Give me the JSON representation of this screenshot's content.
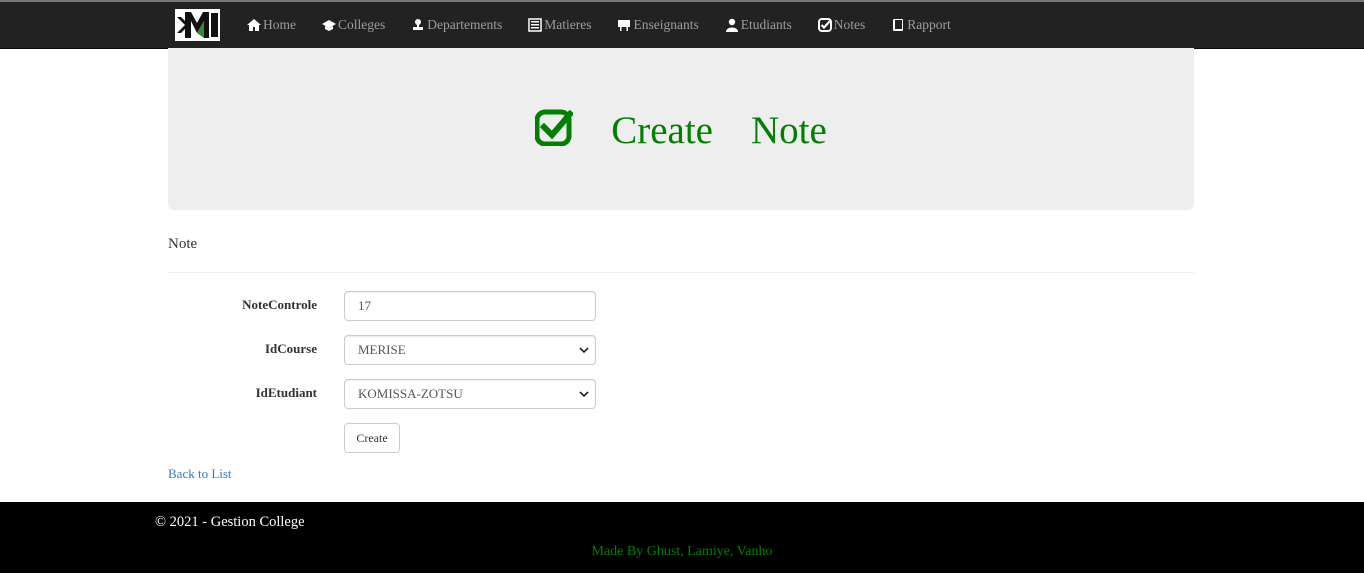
{
  "nav": {
    "items": [
      {
        "label": "Home",
        "icon": "home-icon"
      },
      {
        "label": "Colleges",
        "icon": "graduation-cap-icon"
      },
      {
        "label": "Departements",
        "icon": "stamp-icon"
      },
      {
        "label": "Matieres",
        "icon": "list-icon"
      },
      {
        "label": "Enseignants",
        "icon": "blackboard-icon"
      },
      {
        "label": "Etudiants",
        "icon": "user-icon"
      },
      {
        "label": "Notes",
        "icon": "checkbox-icon"
      },
      {
        "label": "Rapport",
        "icon": "book-icon"
      }
    ]
  },
  "header": {
    "word1": "Create",
    "word2": "Note",
    "color": "#008000"
  },
  "section": {
    "title": "Note"
  },
  "form": {
    "note_label": "NoteControle",
    "note_value": "17",
    "course_label": "IdCourse",
    "course_value": "MERISE",
    "etudiant_label": "IdEtudiant",
    "etudiant_value": "KOMISSA-ZOTSU",
    "submit_label": "Create"
  },
  "back_link": "Back to List",
  "footer": {
    "copyright": "© 2021 - Gestion College",
    "credits": "Made By Ghust, Lamiye, Vanho"
  }
}
